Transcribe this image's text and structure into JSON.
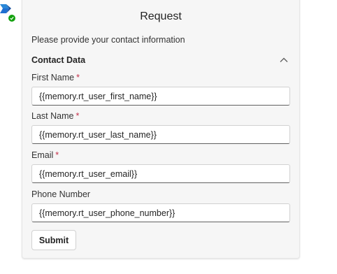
{
  "avatar": {
    "icon": "bot-logo-icon",
    "status_icon": "check-icon",
    "brand_color": "#1f6fd1",
    "status_color": "#13a10e"
  },
  "card": {
    "title": "Request",
    "intro": "Please provide your contact information",
    "section": {
      "title": "Contact Data",
      "toggle_icon": "chevron-up-icon"
    },
    "fields": [
      {
        "label": "First Name",
        "required": "*",
        "value": "{{memory.rt_user_first_name}}"
      },
      {
        "label": "Last Name",
        "required": "*",
        "value": "{{memory.rt_user_last_name}}"
      },
      {
        "label": "Email",
        "required": "*",
        "value": "{{memory.rt_user_email}}"
      },
      {
        "label": "Phone Number",
        "required": "",
        "value": "{{memory.rt_user_phone_number}}"
      }
    ],
    "submit_label": "Submit"
  },
  "colors": {
    "required": "#c4314b",
    "card_background": "#f6f6f6"
  }
}
